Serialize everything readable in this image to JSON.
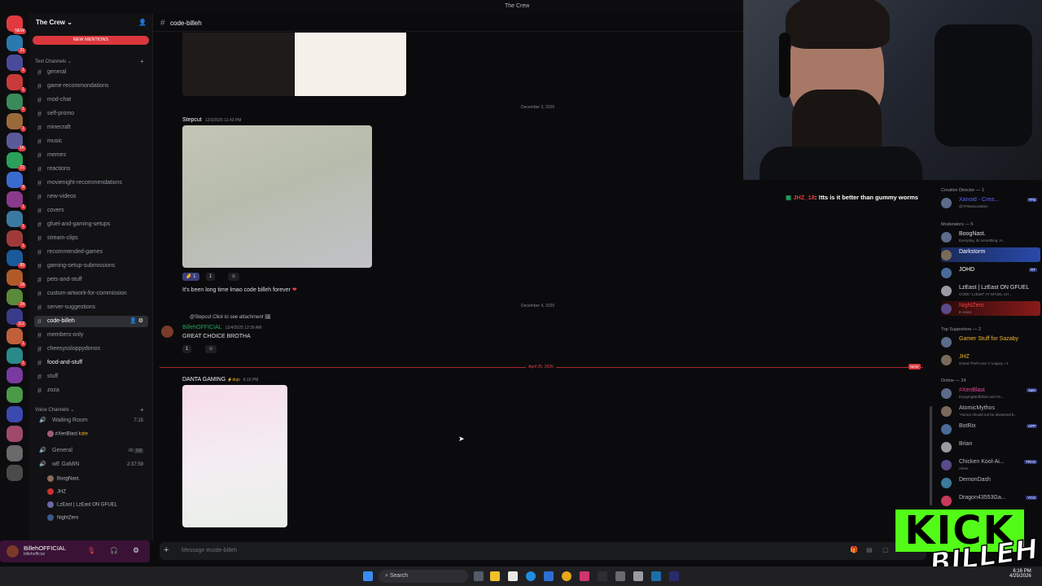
{
  "window": {
    "title": "The Crew"
  },
  "server": {
    "name": "The Crew",
    "new_mentions": "NEW MENTIONS"
  },
  "rail": {
    "badges": [
      "NEW",
      "21",
      "1",
      "1",
      "1",
      "1",
      "1K",
      "22",
      "8",
      "1",
      "1",
      "1",
      "89",
      "18",
      "34",
      "112",
      "1",
      "1"
    ]
  },
  "sidebar": {
    "text_category": "Text Channels",
    "channels": [
      {
        "name": "general",
        "state": "normal"
      },
      {
        "name": "game-recommondations",
        "state": "normal"
      },
      {
        "name": "mod-chat",
        "state": "normal"
      },
      {
        "name": "self-promo",
        "state": "normal"
      },
      {
        "name": "minecraft",
        "state": "normal"
      },
      {
        "name": "music",
        "state": "normal"
      },
      {
        "name": "memes",
        "state": "normal"
      },
      {
        "name": "reactions",
        "state": "normal"
      },
      {
        "name": "movienight-recommendations",
        "state": "normal"
      },
      {
        "name": "new-videos",
        "state": "normal"
      },
      {
        "name": "covers",
        "state": "normal"
      },
      {
        "name": "gfuel-and-gaming-setups",
        "state": "normal"
      },
      {
        "name": "stream-clips",
        "state": "normal"
      },
      {
        "name": "recommended-games",
        "state": "normal"
      },
      {
        "name": "gaming-setup-submissions",
        "state": "normal"
      },
      {
        "name": "pets-and-stuff",
        "state": "normal"
      },
      {
        "name": "custom-artwork-for-commission",
        "state": "normal"
      },
      {
        "name": "server-suggestions",
        "state": "normal"
      },
      {
        "name": "code-billeh",
        "state": "active"
      },
      {
        "name": "members-only",
        "state": "normal"
      },
      {
        "name": "cheesyssloppydonos",
        "state": "normal"
      },
      {
        "name": "food-and-stuff",
        "state": "unread"
      },
      {
        "name": "stuff",
        "state": "normal"
      },
      {
        "name": "zoza",
        "state": "normal"
      }
    ],
    "voice_category": "Voice Channels",
    "voice": {
      "waiting_room": "Waiting Room",
      "waiting_room_time": "7:15",
      "waiting_user": "≠XenBlast",
      "waiting_user_tag": "kate",
      "general": "General",
      "general_count": "00",
      "general_limit": "1/3",
      "wegamin": "wE GaMiN",
      "wegamin_time": "2:37:59",
      "wegamin_users": [
        "BoogNast.",
        "JHZ",
        "LzEast | LzEast ON GFUEL",
        "NightZero"
      ]
    }
  },
  "user_panel": {
    "name": "BillehOFFICIAL",
    "handle": "billehofficial"
  },
  "channel_header": {
    "name": "code-billeh"
  },
  "messages": {
    "date_1": "December 3, 2025",
    "msg1_author": "Stepcut",
    "msg1_time": "12/3/2025 11:43 PM",
    "msg1_react_1": "1",
    "msg1_react_2": "1",
    "msg1_text": "It's been long time lmao code billeh forever",
    "date_2": "December 4, 2025",
    "reply_to": "@Stepcut",
    "reply_hint": "Click to see attachment",
    "msg2_author": "BillehOFFICIAL",
    "msg2_time": "12/4/2025 12:39 AM",
    "msg2_text": "GREAT CHOICE BROTHA",
    "msg2_react": "1",
    "date_3": "April 25, 2026",
    "new_badge": "NEW",
    "msg3_author": "DANTA GAMING",
    "msg3_tag": "dojo",
    "msg3_time": "6:16 PM"
  },
  "chat_overlay": {
    "user": "JHZ_18",
    "text": ": !tts is it better than gummy worms"
  },
  "members": {
    "sections": {
      "creative": "Creative Director — 1",
      "mods": "Moderators — 5",
      "supporters": "Top Supporters — 2",
      "online": "Online — 24"
    },
    "creative": [
      {
        "name": "Xanoid - Crea...",
        "status": "@TFBassociation",
        "tag": "TFB",
        "color": "#5865f2"
      }
    ],
    "mods": [
      {
        "name": "BoogNast.",
        "status": "Everyday, its something. H...",
        "color": "#dbdee1"
      },
      {
        "name": "Darkstorm",
        "status": "",
        "color": "#ffffff"
      },
      {
        "name": "JOHD",
        "status": "",
        "tag": "RT",
        "color": "#ffffff"
      },
      {
        "name": "LzEast | LzEast ON GFUEL",
        "status": "CODE \"LzEast\" AT GFUEL CH...",
        "color": "#dbdee1"
      },
      {
        "name": "NightZero",
        "status": "In voice",
        "color": "#f23f43"
      }
    ],
    "supporters": [
      {
        "name": "Gamer Stuff for Sazaby",
        "status": "",
        "color": "#f0b232"
      },
      {
        "name": "JHZ",
        "status": "Grand Theft Auto V Legacy +1",
        "color": "#f0b232"
      }
    ],
    "online": [
      {
        "name": "≠XenBlast",
        "status": "EnjoyingWolf2k2a and VA...",
        "tag": "kate",
        "color": "#eb459e"
      },
      {
        "name": "AtomicMythos",
        "status": "\"Humor should not be dissected b...",
        "color": "#b5bac1"
      },
      {
        "name": "BotRix",
        "status": "",
        "tag": "APP",
        "color": "#b5bac1"
      },
      {
        "name": "Brian",
        "status": "",
        "color": "#b5bac1"
      },
      {
        "name": "Chicken Kool-Ai...",
        "status": "Alone",
        "tag": "TRAX",
        "color": "#b5bac1"
      },
      {
        "name": "DemonDash",
        "status": "",
        "color": "#b5bac1"
      },
      {
        "name": "Dragon43553Ga...",
        "status": "",
        "tag": "YCG",
        "color": "#b5bac1"
      }
    ]
  },
  "composer": {
    "placeholder": "Message #code-billeh"
  },
  "taskbar": {
    "search": "Search",
    "time": "6:16 PM",
    "date": "4/25/2026"
  },
  "overlay": {
    "kick": "KICK",
    "billeh": "BILLEH"
  },
  "colors": {
    "accent": "#da373c",
    "active_channel": "#2e2f34",
    "green": "#23a559"
  }
}
